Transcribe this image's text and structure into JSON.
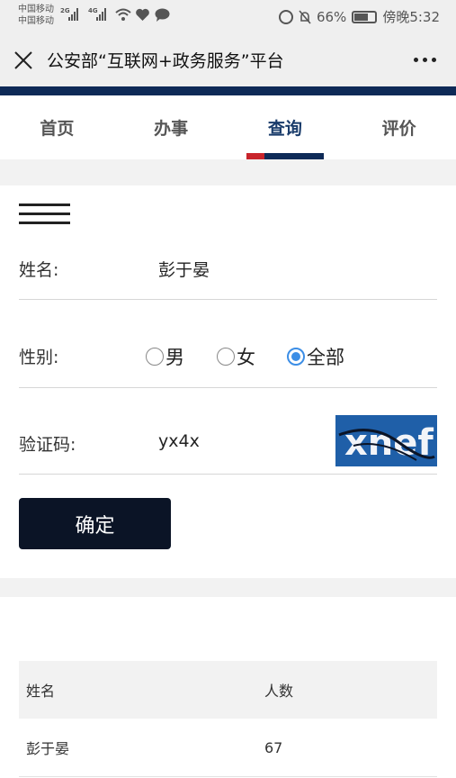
{
  "status_bar": {
    "carrier_1": "中国移动",
    "carrier_2": "中国移动",
    "sig1_tag": "2G",
    "sig2_tag": "4G",
    "battery": "66%",
    "time": "傍晚5:32"
  },
  "header": {
    "title": "公安部“互联网+政务服务”平台"
  },
  "nav": {
    "tabs": [
      {
        "label": "首页"
      },
      {
        "label": "办事"
      },
      {
        "label": "查询"
      },
      {
        "label": "评价"
      }
    ],
    "active_index": 2
  },
  "form": {
    "name_label": "姓名:",
    "name_value": "彭于晏",
    "gender_label": "性别:",
    "gender_options": [
      {
        "label": "男",
        "checked": false
      },
      {
        "label": "女",
        "checked": false
      },
      {
        "label": "全部",
        "checked": true
      }
    ],
    "captcha_label": "验证码:",
    "captcha_input": "yx4x",
    "captcha_image_text": "xnef",
    "confirm_label": "确定"
  },
  "results": {
    "columns": [
      "姓名",
      "人数"
    ],
    "rows": [
      {
        "name": "彭于晏",
        "count": "67"
      }
    ]
  },
  "colors": {
    "brand_navy": "#0e2a57",
    "brand_red": "#c8242b",
    "button_bg": "#0b1426",
    "radio_checked": "#3c8ee6"
  }
}
